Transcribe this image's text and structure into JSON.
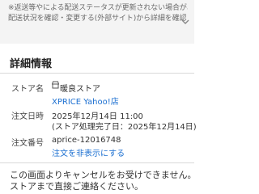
{
  "notice": {
    "lines": [
      "※返送等やによる配送ステータスが更新されない場合があります。",
      "配送状況を確認・変更する(外部サイト)から詳細を確認ください"
    ]
  },
  "details": {
    "title": "詳細情報",
    "store_label": "ストア名",
    "store_name": "暖良ストア",
    "store_link": "XPRICE Yahoo!店",
    "date_label": "注文日時",
    "date_value": "2025年12月14日 11:00",
    "date_sub": "(ストア処理完了日：2025年12月14日)",
    "order_label": "注文番号",
    "order_number": "aprice-12016748",
    "order_link": "注文を非表示にする"
  },
  "cancel_notice": {
    "lines": [
      "この画面よりキャンセルをお受けできません。",
      "ストアまで直接ご連絡ください。"
    ]
  }
}
